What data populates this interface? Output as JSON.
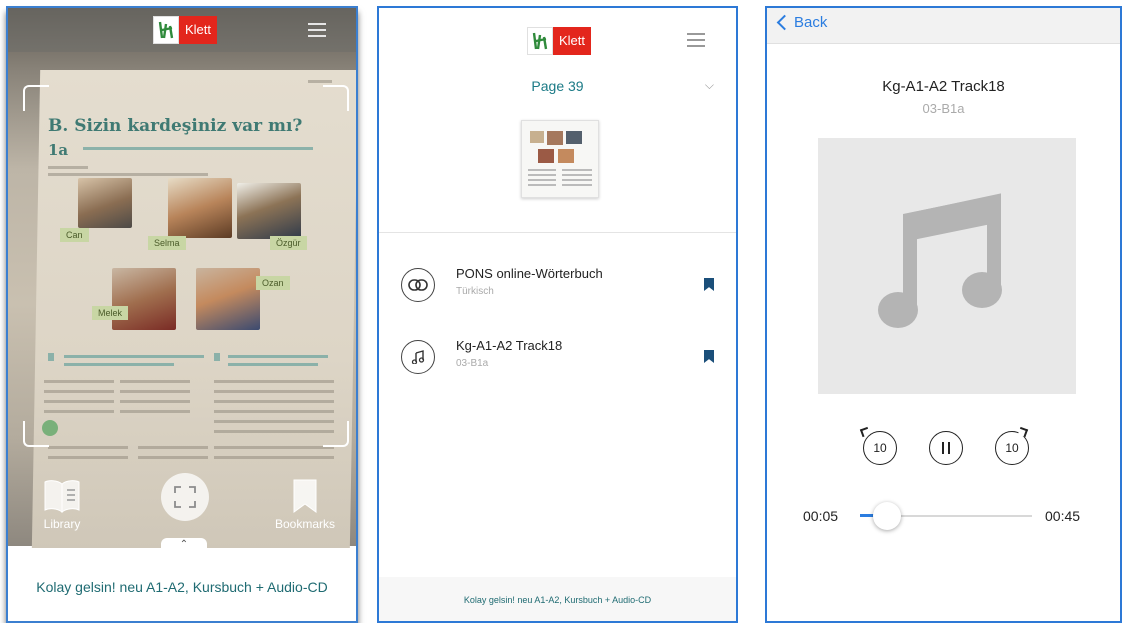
{
  "screen1": {
    "logo_text": "Klett",
    "book_page": {
      "heading": "B. Sizin kardeşiniz var mı?",
      "exercise": "1a",
      "names": [
        "Can",
        "Selma",
        "Özgür",
        "Melek",
        "Ozan"
      ]
    },
    "library_label": "Library",
    "bookmarks_label": "Bookmarks",
    "expand_glyph": "⌃",
    "book_title": "Kolay gelsin! neu A1-A2, Kursbuch + Audio-CD"
  },
  "screen2": {
    "logo_text": "Klett",
    "page_label": "Page 39",
    "chevron_glyph": "⌵",
    "items": [
      {
        "title": "PONS online-Wörterbuch",
        "subtitle": "Türkisch",
        "icon": "link-icon"
      },
      {
        "title": "Kg-A1-A2 Track18",
        "subtitle": "03-B1a",
        "icon": "music-note-icon"
      }
    ],
    "footer": "Kolay gelsin! neu A1-A2, Kursbuch + Audio-CD"
  },
  "screen3": {
    "back_label": "Back",
    "track_title": "Kg-A1-A2 Track18",
    "track_subtitle": "03-B1a",
    "rewind_label": "10",
    "forward_label": "10",
    "elapsed": "00:05",
    "duration": "00:45",
    "progress": 0.11,
    "accent": "#2b7de0"
  }
}
